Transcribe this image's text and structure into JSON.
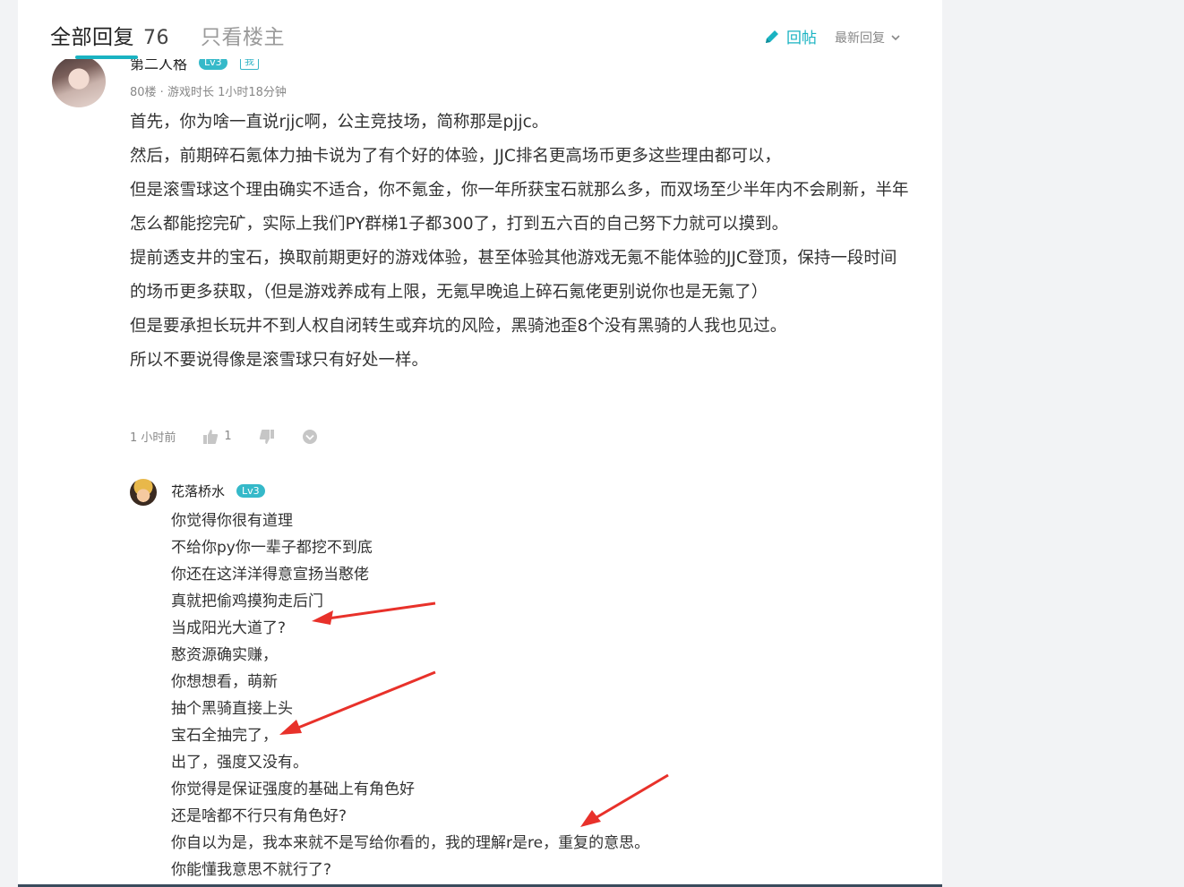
{
  "header": {
    "tab_all_label": "全部回复",
    "tab_all_count": "76",
    "tab_op_label": "只看楼主",
    "reply_label": "回帖",
    "sort_label": "最新回复"
  },
  "post": {
    "username": "第二人格",
    "level": "Lv3",
    "tag": "我",
    "meta": "80楼 · 游戏时长 1小时18分钟",
    "lines": [
      "首先，你为啥一直说rjjc啊，公主竞技场，简称那是pjjc。",
      "然后，前期碎石氪体力抽卡说为了有个好的体验，JJC排名更高场币更多这些理由都可以，",
      "但是滚雪球这个理由确实不适合，你不氪金，你一年所获宝石就那么多，而双场至少半年内不会刷新，半年怎么都能挖完矿，实际上我们PY群梯1子都300了，打到五六百的自己努下力就可以摸到。",
      "提前透支井的宝石，换取前期更好的游戏体验，甚至体验其他游戏无氪不能体验的JJC登顶，保持一段时间的场币更多获取，（但是游戏养成有上限，无氪早晚追上碎石氪佬更别说你也是无氪了）",
      "但是要承担长玩井不到人权自闭转生或弃坑的风险，黑骑池歪8个没有黑骑的人我也见过。",
      "所以不要说得像是滚雪球只有好处一样。"
    ],
    "time": "1 小时前",
    "like_count": "1"
  },
  "sub_reply": {
    "username": "花落桥水",
    "level": "Lv3",
    "lines": [
      "你觉得你很有道理",
      "不给你py你一辈子都挖不到底",
      "你还在这洋洋得意宣扬当憨佬",
      "真就把偷鸡摸狗走后门",
      "当成阳光大道了?",
      "憨资源确实赚，",
      "你想想看，萌新",
      "抽个黑骑直接上头",
      "宝石全抽完了，",
      "出了，强度又没有。",
      "你觉得是保证强度的基础上有角色好",
      "还是啥都不行只有角色好?",
      "你自以为是，我本来就不是写给你看的，我的理解r是re，重复的意思。",
      "你能懂我意思不就行了?"
    ]
  },
  "colors": {
    "accent": "#1ab3c2",
    "arrow": "#e8312a"
  },
  "icons": [
    "pencil-icon",
    "chevron-down-icon",
    "thumb-up-icon",
    "thumb-down-icon",
    "more-icon"
  ]
}
